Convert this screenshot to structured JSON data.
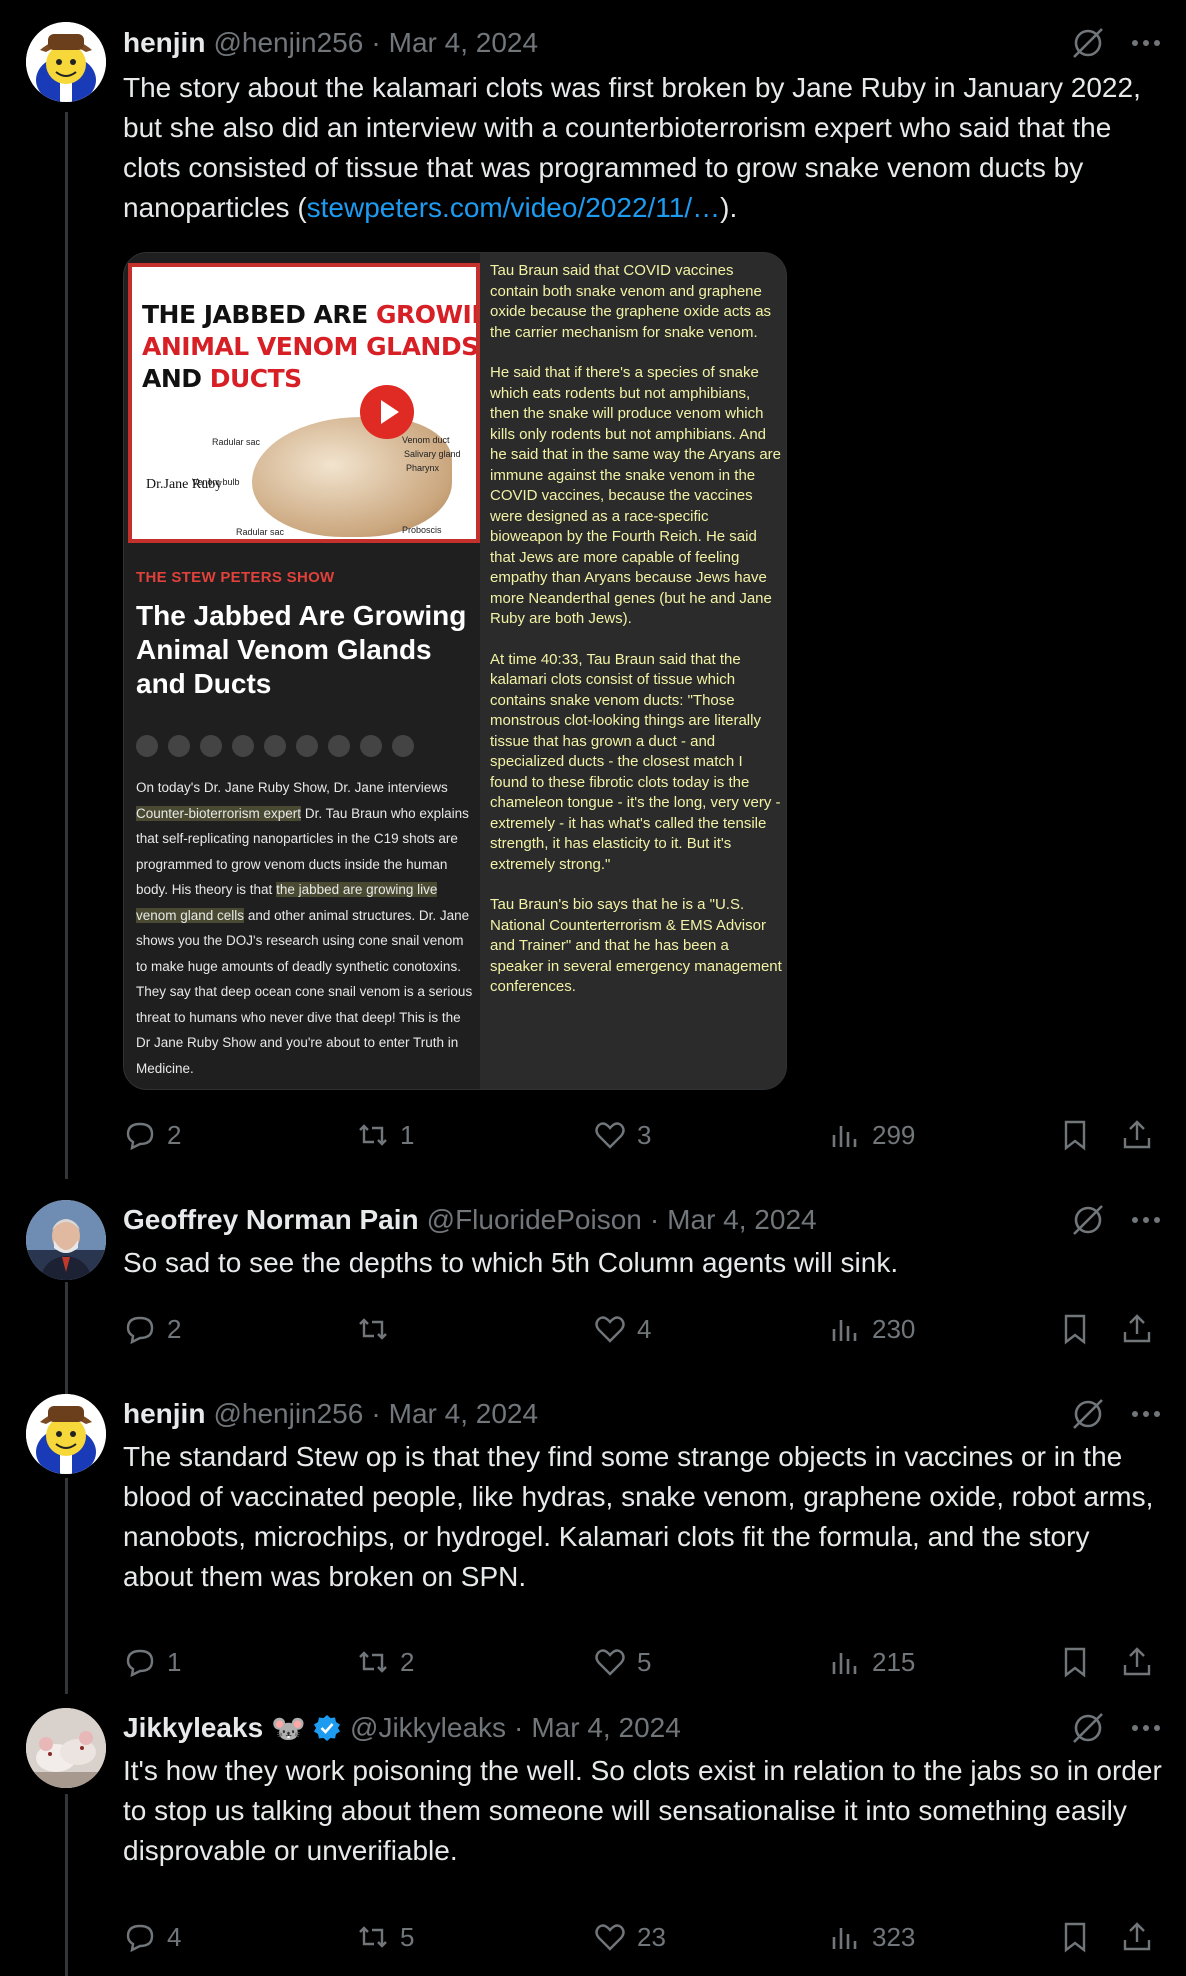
{
  "colors": {
    "background": "#000000",
    "text": "#e7e9ea",
    "muted": "#71767b",
    "link": "#1d9bf0",
    "thread_line": "#333639",
    "verified": "#1d9bf0"
  },
  "icons": {
    "grok": "grok-icon",
    "more": "more-icon",
    "reply": "reply-icon",
    "retweet": "retweet-icon",
    "like": "like-icon",
    "views": "views-icon",
    "bookmark": "bookmark-icon",
    "share": "share-icon"
  },
  "tweets": [
    {
      "name": "henjin",
      "handle": "@henjin256",
      "sep": "·",
      "date": "Mar 4, 2024",
      "text_before": "The story about the kalamari clots was first broken by Jane Ruby in January 2022, but she also did an interview with a counterbioterrorism expert who said that the clots consisted of tissue that was programmed to grow snake venom ducts by nanoparticles (",
      "link": "stewpeters.com/video/2022/11/…",
      "text_after": ").",
      "replies": "2",
      "retweets": "1",
      "likes": "3",
      "views": "299"
    },
    {
      "name": "Geoffrey Norman Pain",
      "handle": "@FluoridePoison",
      "sep": "·",
      "date": "Mar 4, 2024",
      "text": "So sad to see the depths to which 5th Column agents will sink.",
      "replies": "2",
      "retweets": "",
      "likes": "4",
      "views": "230"
    },
    {
      "name": "henjin",
      "handle": "@henjin256",
      "sep": "·",
      "date": "Mar 4, 2024",
      "text": "The standard Stew op is that they find some strange objects in vaccines or in the blood of vaccinated people, like hydras, snake venom, graphene oxide, robot arms, nanobots, microchips, or hydrogel. Kalamari clots fit the formula, and the story about them was broken on SPN.",
      "replies": "1",
      "retweets": "2",
      "likes": "5",
      "views": "215"
    },
    {
      "name": "Jikkyleaks",
      "emoji": "🐭",
      "handle": "@Jikkyleaks",
      "sep": "·",
      "date": "Mar 4, 2024",
      "text": "It's how they work poisoning the well. So clots exist in relation to the jabs so in order to stop us talking about them someone will sensationalise it into something easily disprovable or unverifiable.",
      "replies": "4",
      "retweets": "5",
      "likes": "23",
      "views": "323"
    }
  ],
  "media": {
    "thumb_line1_a": "THE JABBED ARE ",
    "thumb_line1_b": "GROWING",
    "thumb_line2": "ANIMAL VENOM GLANDS",
    "thumb_line3_a": "AND ",
    "thumb_line3_b": "DUCTS",
    "thumb_logo": "Dr.Jane Ruby",
    "thumb_labels": [
      "Radular sac",
      "Venom bulb",
      "Venom duct",
      "Salivary gland",
      "Pharynx",
      "Proboscis",
      "Radular sac"
    ],
    "show_name": "THE STEW PETERS SHOW",
    "show_title": "The Jabbed Are Growing Animal Venom Glands and Ducts",
    "desc_1": "On today's Dr. Jane Ruby Show, Dr. Jane interviews ",
    "desc_hl1": "Counter-bioterrorism expert",
    "desc_2": " Dr. Tau Braun who explains that self-replicating nanoparticles in the C19 shots are programmed to grow venom ducts inside the human body. His theory is that ",
    "desc_hl2": "the jabbed are growing live venom gland cells",
    "desc_3": " and other animal structures. Dr. Jane shows you the DOJ's research using cone snail venom to make huge amounts of deadly synthetic conotoxins. They say that deep ocean cone snail venom is a serious threat to humans who never dive that deep! This is the Dr Jane Ruby Show and you're about to enter Truth in Medicine.",
    "right_p1": "Tau Braun said that COVID vaccines contain both snake venom and graphene oxide because the graphene oxide acts as the carrier mechanism for snake venom.",
    "right_p2": "He said that if there's a species of snake which eats rodents but not amphibians, then the snake will produce venom which kills only rodents but not amphibians. And he said that in the same way the Aryans are immune against the snake venom in the COVID vaccines, because the vaccines were designed as a race-specific bioweapon by the Fourth Reich. He said that Jews are more capable of feeling empathy than Aryans because Jews have more Neanderthal genes (but he and Jane Ruby are both Jews).",
    "right_p3": "At time 40:33, Tau Braun said that the kalamari clots consist of tissue which contains snake venom ducts: \"Those monstrous clot-looking things are literally tissue that has grown a duct - and specialized ducts - the closest match I found to these fibrotic clots today is the chameleon tongue - it's the long, very very - extremely - it has what's called the tensile strength, it has elasticity to it. But it's extremely strong.\"",
    "right_p4": "Tau Braun's bio says that he is a \"U.S. National Counterterrorism & EMS Advisor and Trainer\" and that he has been a speaker in several emergency management conferences."
  }
}
